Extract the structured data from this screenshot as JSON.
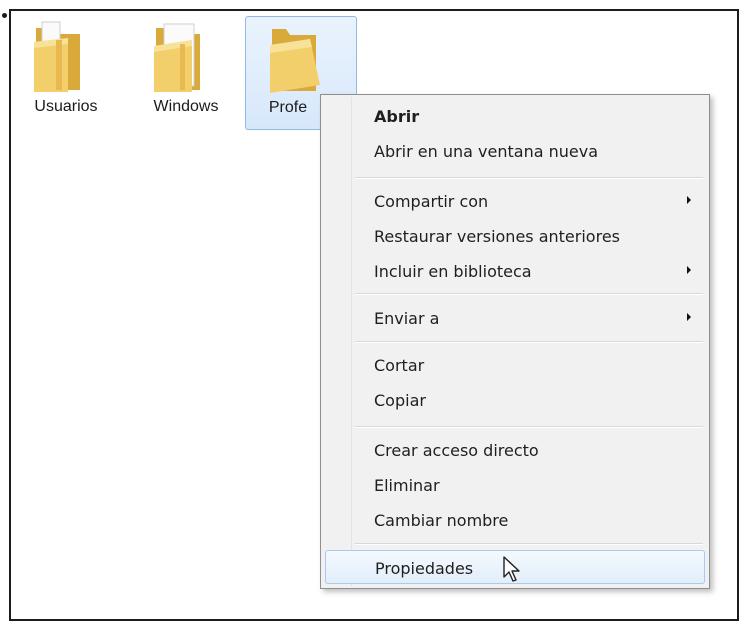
{
  "desktop": {
    "folders": [
      {
        "label": "Usuarios",
        "icon": "folder-icon",
        "selected": false
      },
      {
        "label": "Windows",
        "icon": "folder-icon",
        "selected": false
      },
      {
        "label": "Profe",
        "icon": "folder-icon",
        "selected": true
      }
    ]
  },
  "context_menu": {
    "items": [
      {
        "label": "Abrir",
        "bold": true
      },
      {
        "label": "Abrir en una ventana nueva"
      },
      {
        "label": "Compartir con",
        "submenu": true
      },
      {
        "label": "Restaurar versiones anteriores"
      },
      {
        "label": "Incluir en biblioteca",
        "submenu": true
      },
      {
        "label": "Enviar a",
        "submenu": true
      },
      {
        "label": "Cortar"
      },
      {
        "label": "Copiar"
      },
      {
        "label": "Crear acceso directo"
      },
      {
        "label": "Eliminar"
      },
      {
        "label": "Cambiar nombre"
      },
      {
        "label": "Propiedades",
        "highlighted": true
      }
    ]
  },
  "colors": {
    "folder_yellow": "#f2cf6b",
    "selection_border": "#92b8e6",
    "menu_background": "#f1f1f1"
  }
}
